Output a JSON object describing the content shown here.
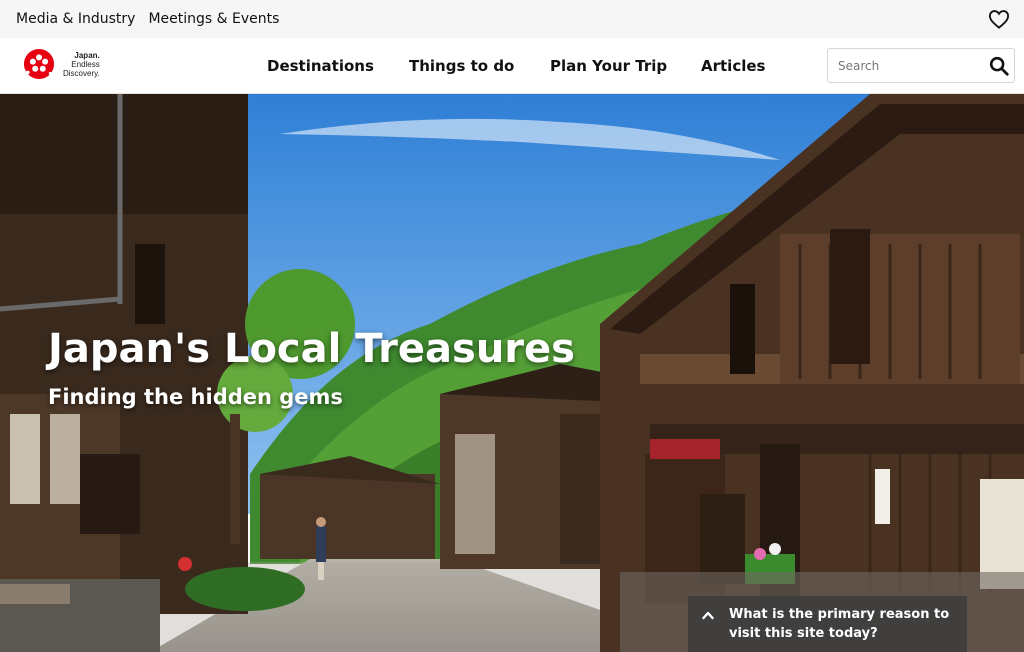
{
  "utility_nav": {
    "links": [
      "Media & Industry",
      "Meetings & Events"
    ],
    "favorites_icon": "heart-icon"
  },
  "brand": {
    "logo_line1": "Japan.",
    "logo_line2": "Endless",
    "logo_line3": "Discovery.",
    "logo_color": "#e60012"
  },
  "main_nav": {
    "items": [
      "Destinations",
      "Things to do",
      "Plan Your Trip",
      "Articles"
    ]
  },
  "search": {
    "placeholder": "Search",
    "icon": "search-icon"
  },
  "hero": {
    "title": "Japan's Local Treasures",
    "subtitle": "Finding the hidden gems"
  },
  "survey": {
    "text": "What is the primary reason to visit this site today?",
    "icon": "chevron-up-icon"
  }
}
